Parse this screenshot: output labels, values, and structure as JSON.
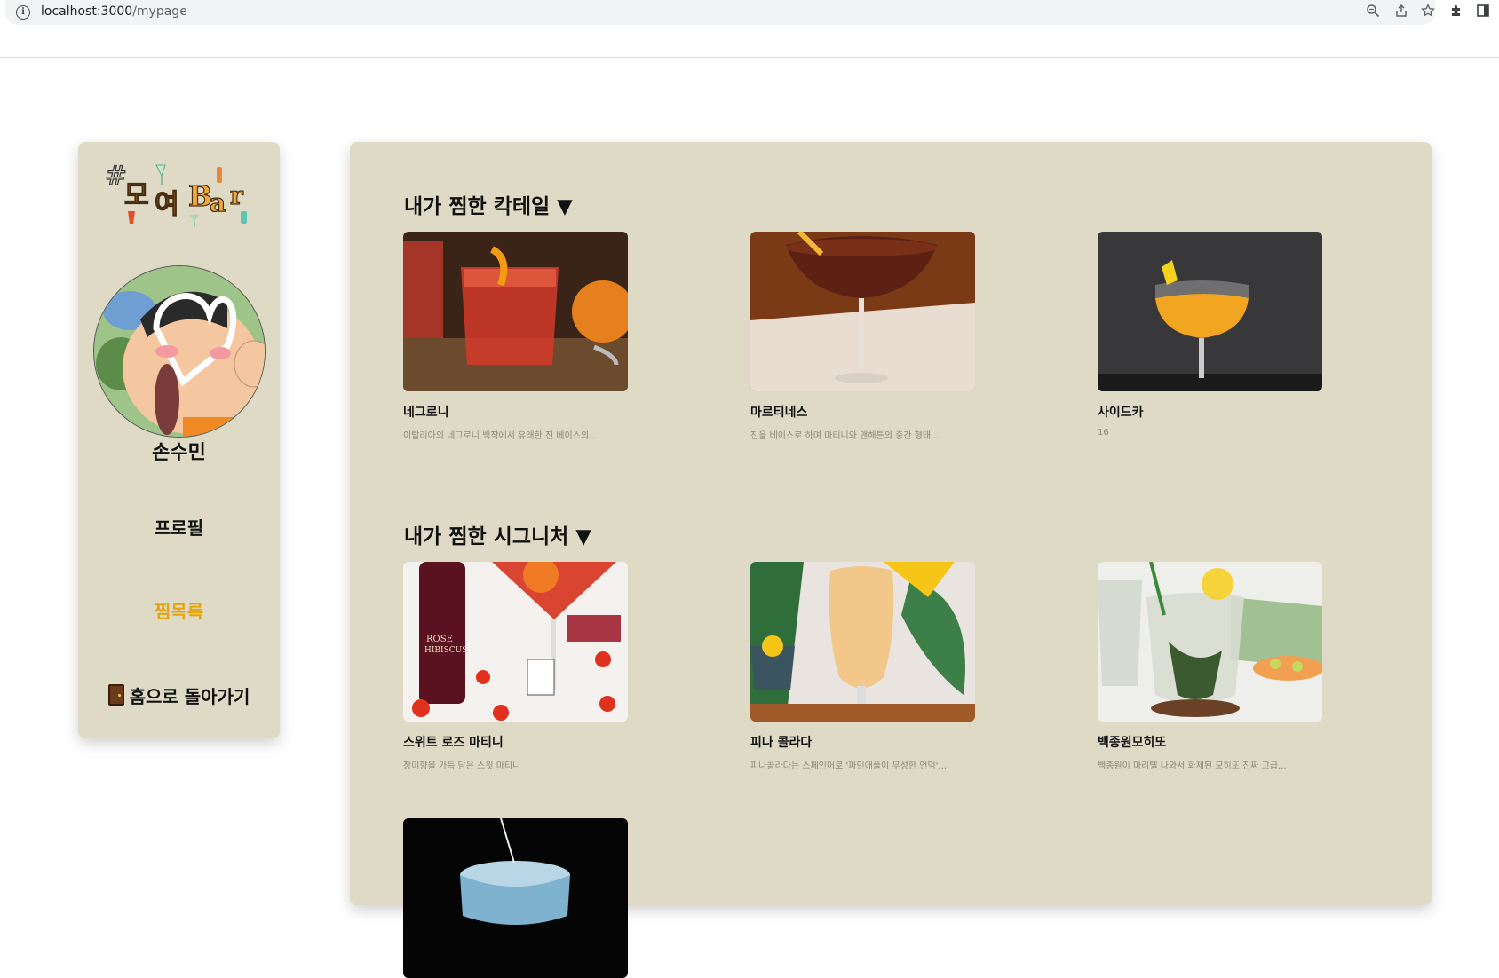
{
  "browser": {
    "url_host": "localhost:3000",
    "url_path": "/mypage"
  },
  "sidebar": {
    "logo_text": "#모여Bar",
    "username": "손수민",
    "nav": {
      "profile": "프로필",
      "wishlist": "찜목록",
      "home": "홈으로 돌아가기"
    },
    "active_color": "#e5a50a"
  },
  "main": {
    "cocktails_title": "내가 찜한 칵테일 ▼",
    "cocktails": [
      {
        "name": "네그로니",
        "desc": "이탈리아의 네그로니 백작에서 유래한 진 베이스의..."
      },
      {
        "name": "마르티네스",
        "desc": "진을 베이스로 하며 마티니와 맨해튼의 중간 형태..."
      },
      {
        "name": "사이드카",
        "desc": "16"
      }
    ],
    "signatures_title": "내가 찜한 시그니처 ▼",
    "signatures": [
      {
        "name": "스위트 로즈 마티니",
        "desc": "장미향을 가득 담은 스윗 마티니"
      },
      {
        "name": "피나 콜라다",
        "desc": "피나콜라다는 스페인어로 '파인애플이 무성한 언덕'..."
      },
      {
        "name": "백종원모히또",
        "desc": "백종원이 마리텔 나와서 화제된 모히또 진짜 고급..."
      },
      {
        "name": "",
        "desc": ""
      }
    ]
  },
  "colors": {
    "panel_bg": "#dedac5",
    "text": "#111111",
    "desc_text": "#8a8776"
  }
}
